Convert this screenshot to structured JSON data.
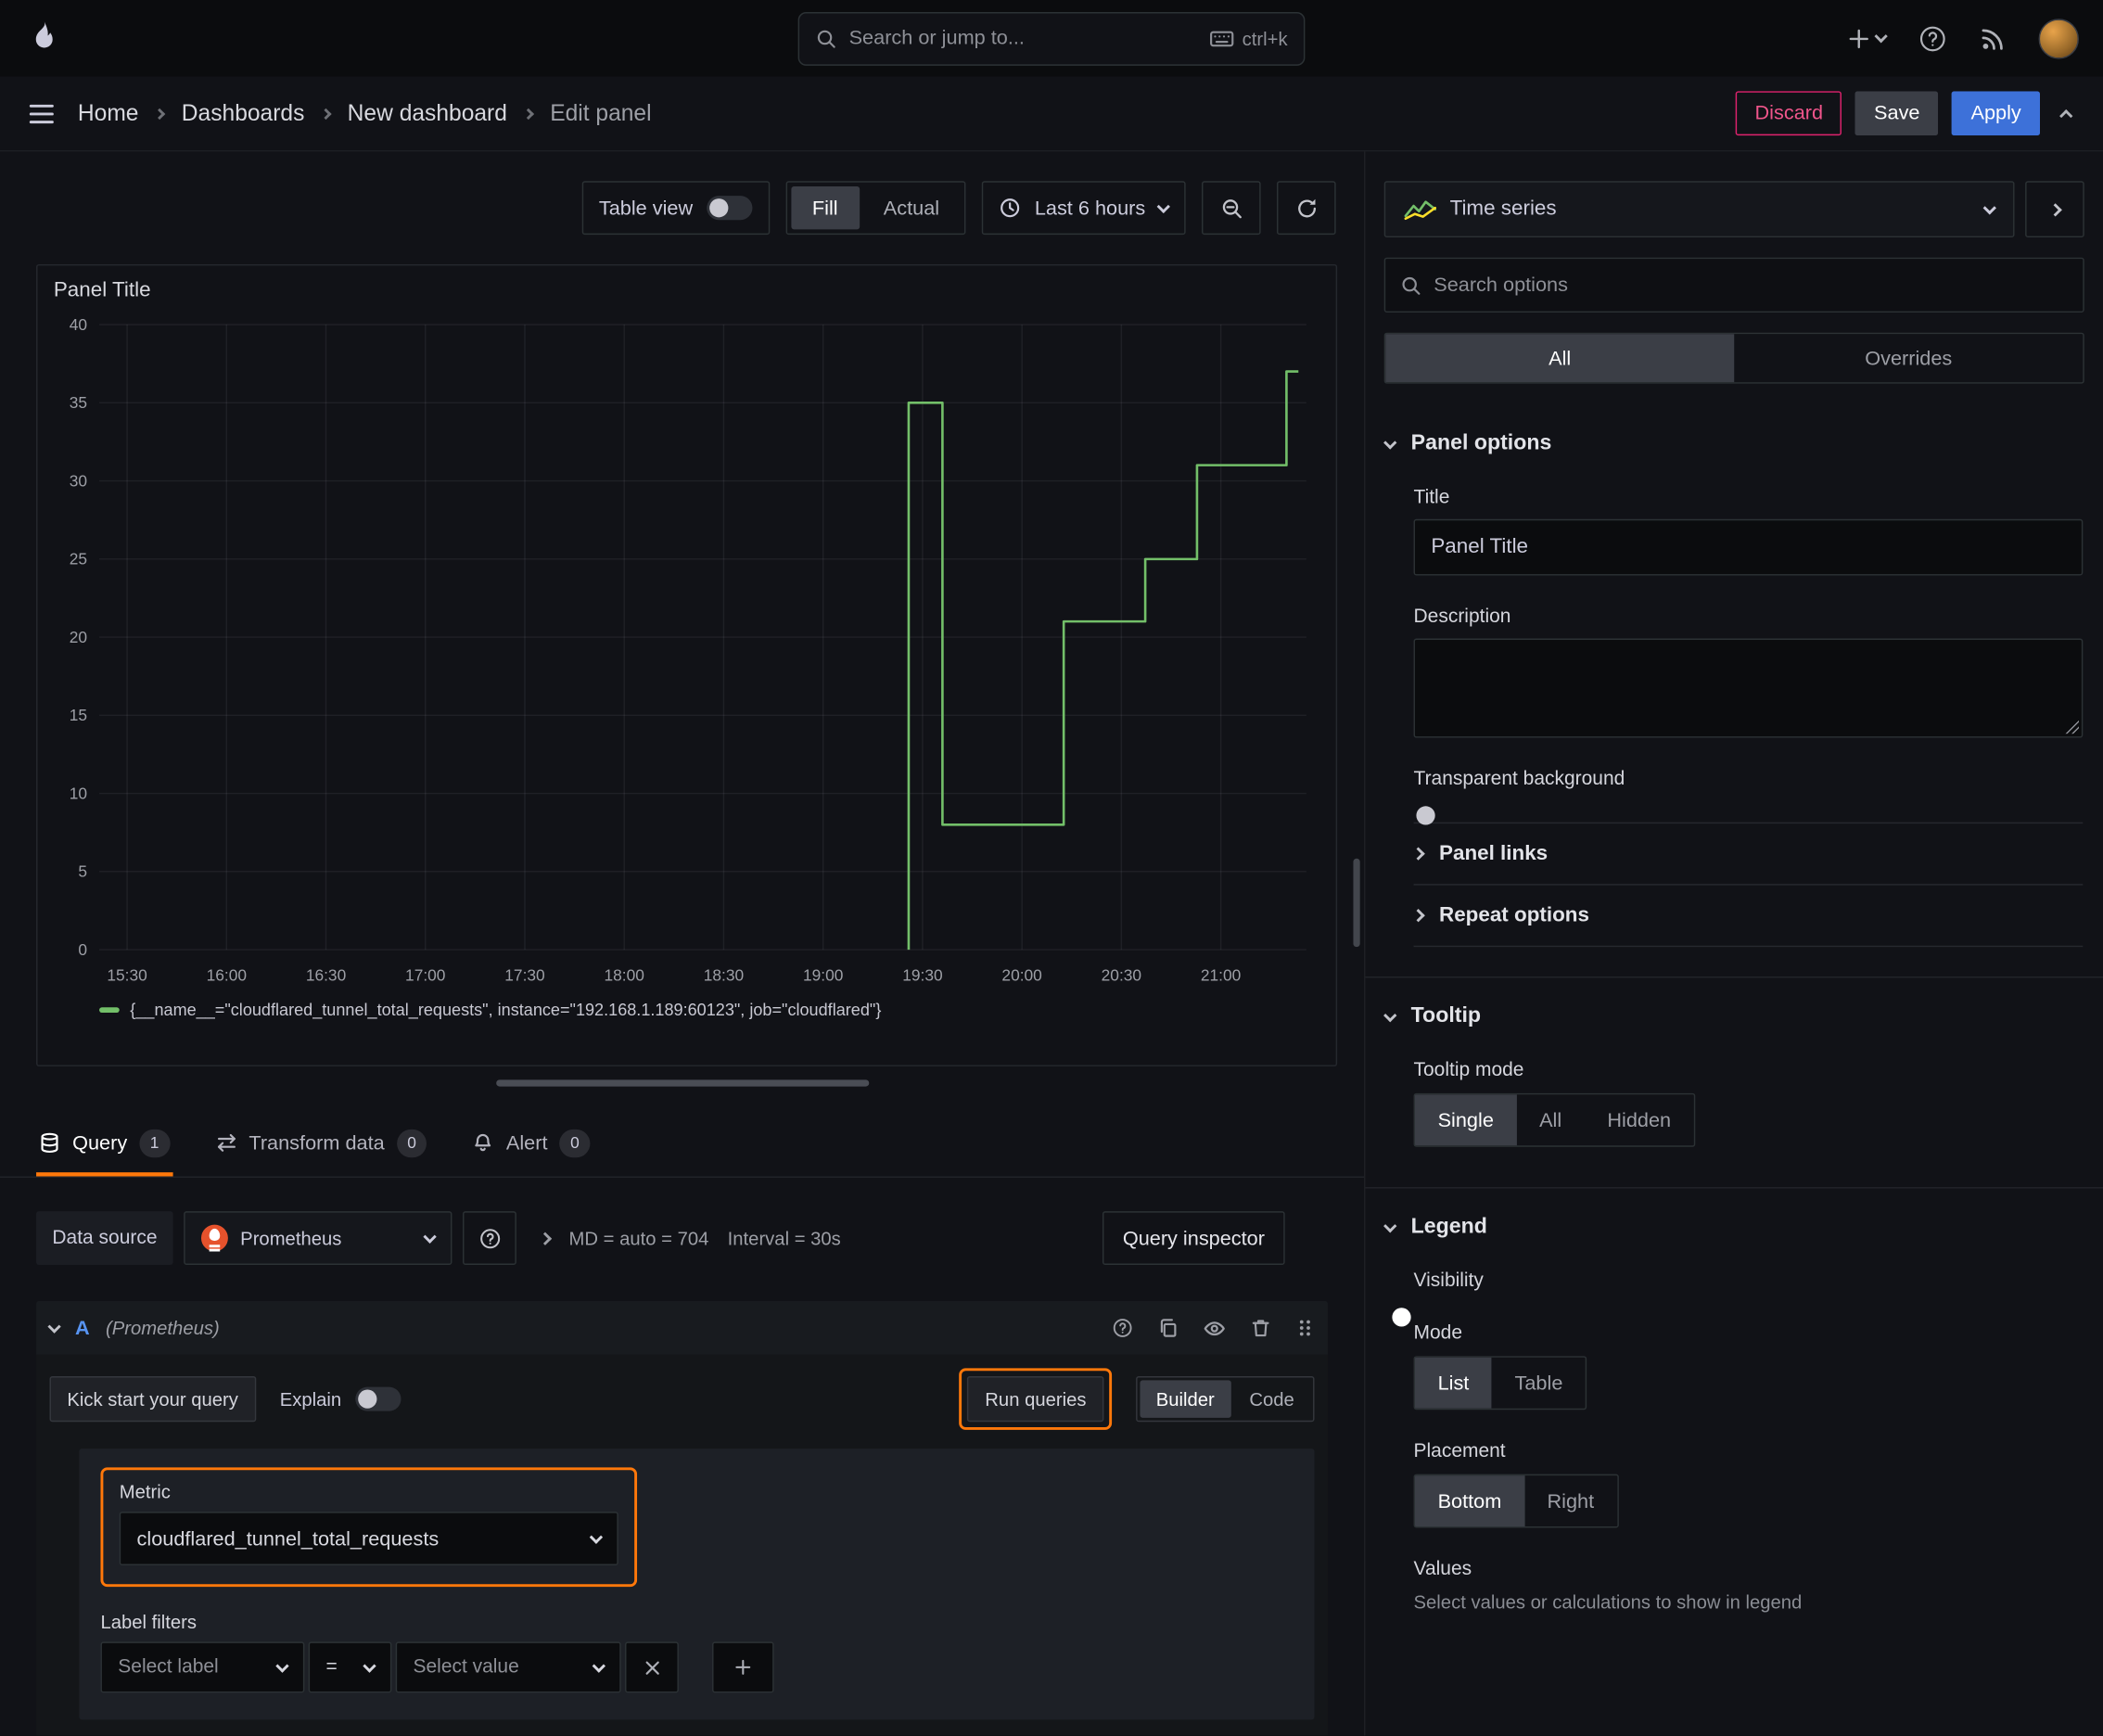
{
  "colors": {
    "accent_blue": "#3d71d9",
    "accent_orange": "#ff780a",
    "destructive_pink": "#e0226e",
    "series_green": "#73bf69"
  },
  "topbar": {
    "search_placeholder": "Search or jump to...",
    "search_shortcut": "ctrl+k"
  },
  "breadcrumbs": {
    "items": [
      "Home",
      "Dashboards",
      "New dashboard",
      "Edit panel"
    ]
  },
  "header_actions": {
    "discard": "Discard",
    "save": "Save",
    "apply": "Apply"
  },
  "panel_toolbar": {
    "table_view": "Table view",
    "fill": "Fill",
    "actual": "Actual",
    "time_range": "Last 6 hours"
  },
  "panel": {
    "title": "Panel Title"
  },
  "chart_data": {
    "type": "line",
    "title": "Panel Title",
    "xlabel": "",
    "ylabel": "",
    "xlim": [
      15.36,
      21.43
    ],
    "ylim": [
      0,
      40
    ],
    "y_ticks": [
      0,
      5,
      10,
      15,
      20,
      25,
      30,
      35,
      40
    ],
    "x_ticks": [
      {
        "value": 15.5,
        "label": "15:30"
      },
      {
        "value": 16.0,
        "label": "16:00"
      },
      {
        "value": 16.5,
        "label": "16:30"
      },
      {
        "value": 17.0,
        "label": "17:00"
      },
      {
        "value": 17.5,
        "label": "17:30"
      },
      {
        "value": 18.0,
        "label": "18:00"
      },
      {
        "value": 18.5,
        "label": "18:30"
      },
      {
        "value": 19.0,
        "label": "19:00"
      },
      {
        "value": 19.5,
        "label": "19:30"
      },
      {
        "value": 20.0,
        "label": "20:00"
      },
      {
        "value": 20.5,
        "label": "20:30"
      },
      {
        "value": 21.0,
        "label": "21:00"
      }
    ],
    "grid": true,
    "legend_position": "bottom",
    "series": [
      {
        "name": "{__name__=\"cloudflared_tunnel_total_requests\", instance=\"192.168.1.189:60123\", job=\"cloudflared\"}",
        "color": "#73bf69",
        "step": true,
        "points": [
          [
            19.43,
            0
          ],
          [
            19.43,
            35
          ],
          [
            19.6,
            35
          ],
          [
            19.6,
            8
          ],
          [
            20.21,
            8
          ],
          [
            20.21,
            21
          ],
          [
            20.62,
            21
          ],
          [
            20.62,
            25
          ],
          [
            20.88,
            25
          ],
          [
            20.88,
            31
          ],
          [
            21.33,
            31
          ],
          [
            21.33,
            37
          ],
          [
            21.39,
            37
          ]
        ]
      }
    ]
  },
  "editor_tabs": {
    "query": "Query",
    "query_count": "1",
    "transform": "Transform data",
    "transform_count": "0",
    "alert": "Alert",
    "alert_count": "0"
  },
  "datasource_row": {
    "label": "Data source",
    "datasource": "Prometheus",
    "max_data_points": "MD = auto = 704",
    "interval": "Interval = 30s",
    "query_inspector": "Query inspector"
  },
  "query_editor": {
    "ref_id": "A",
    "datasource_hint": "(Prometheus)",
    "kick_start": "Kick start your query",
    "explain": "Explain",
    "run_queries": "Run queries",
    "builder": "Builder",
    "code": "Code",
    "metric_label": "Metric",
    "metric_value": "cloudflared_tunnel_total_requests",
    "label_filters_label": "Label filters",
    "select_label_placeholder": "Select label",
    "operator": "=",
    "select_value_placeholder": "Select value"
  },
  "viz_picker": {
    "name": "Time series"
  },
  "options_pane": {
    "search_placeholder": "Search options",
    "tabs": {
      "all": "All",
      "overrides": "Overrides"
    },
    "panel_options": {
      "title": "Panel options",
      "title_label": "Title",
      "title_value": "Panel Title",
      "description_label": "Description",
      "transparent_label": "Transparent background",
      "panel_links": "Panel links",
      "repeat_options": "Repeat options"
    },
    "tooltip": {
      "title": "Tooltip",
      "mode_label": "Tooltip mode",
      "options": [
        "Single",
        "All",
        "Hidden"
      ],
      "selected": "Single"
    },
    "legend": {
      "title": "Legend",
      "visibility_label": "Visibility",
      "mode_label": "Mode",
      "mode_options": [
        "List",
        "Table"
      ],
      "mode_selected": "List",
      "placement_label": "Placement",
      "placement_options": [
        "Bottom",
        "Right"
      ],
      "placement_selected": "Bottom",
      "values_label": "Values",
      "values_description": "Select values or calculations to show in legend"
    }
  }
}
